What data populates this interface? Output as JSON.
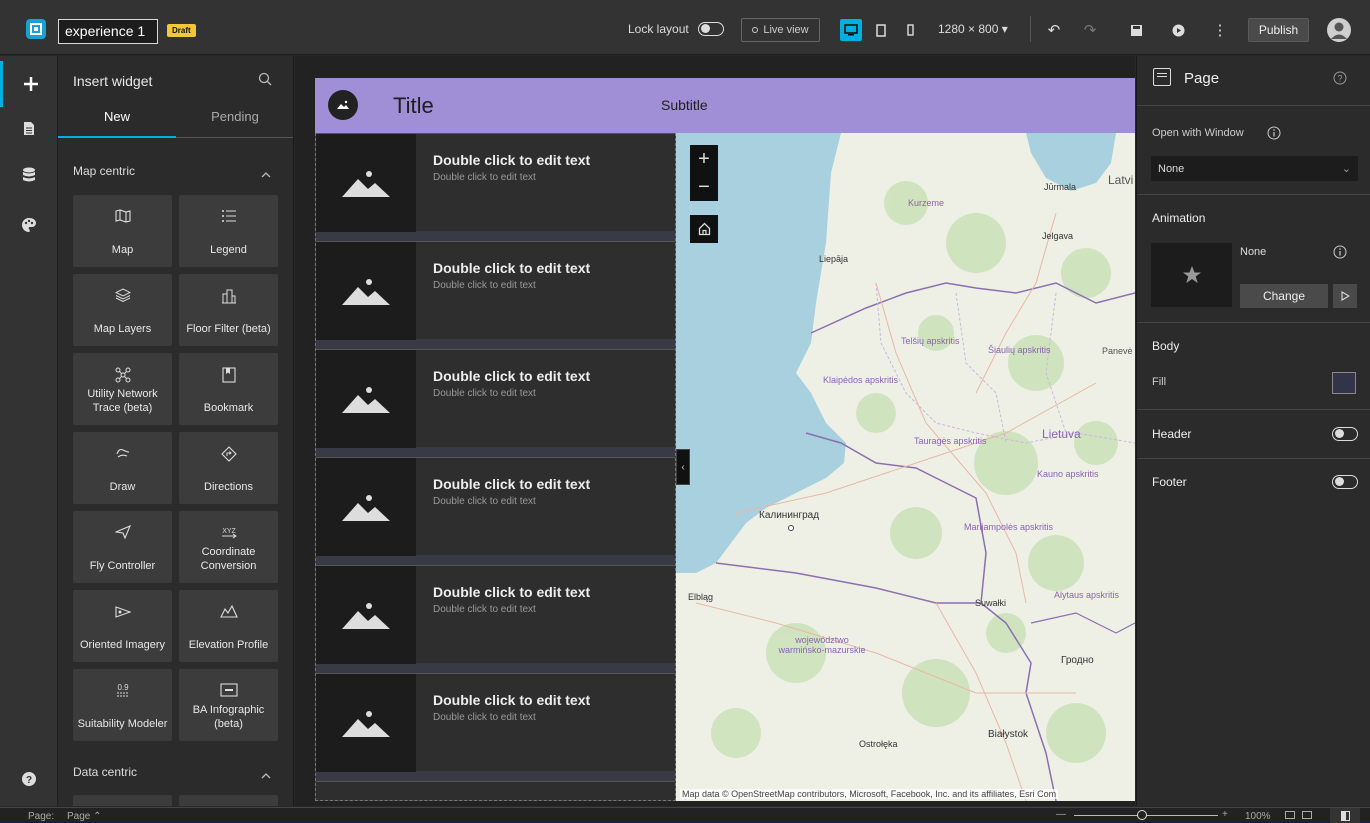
{
  "topbar": {
    "experience_title": "experience 1",
    "draft_badge": "Draft",
    "lock_layout_label": "Lock layout",
    "live_view_label": "Live view",
    "resolution": "1280 × 800",
    "publish_label": "Publish"
  },
  "insert_panel": {
    "title": "Insert widget",
    "tabs": [
      "New",
      "Pending"
    ],
    "section_map": "Map centric",
    "section_data": "Data centric",
    "widgets": [
      {
        "label": "Map",
        "icon": "map-icon"
      },
      {
        "label": "Legend",
        "icon": "legend-icon"
      },
      {
        "label": "Map Layers",
        "icon": "layers-icon"
      },
      {
        "label": "Floor Filter (beta)",
        "icon": "floor-filter-icon"
      },
      {
        "label": "Utility Network Trace (beta)",
        "icon": "utility-network-icon"
      },
      {
        "label": "Bookmark",
        "icon": "bookmark-icon"
      },
      {
        "label": "Draw",
        "icon": "draw-icon"
      },
      {
        "label": "Directions",
        "icon": "directions-icon"
      },
      {
        "label": "Fly Controller",
        "icon": "fly-controller-icon"
      },
      {
        "label": "Coordinate Conversion",
        "icon": "coordinate-icon"
      },
      {
        "label": "Oriented Imagery",
        "icon": "oriented-imagery-icon"
      },
      {
        "label": "Elevation Profile",
        "icon": "elevation-icon"
      },
      {
        "label": "Suitability Modeler",
        "icon": "suitability-icon"
      },
      {
        "label": "BA Infographic (beta)",
        "icon": "infographic-icon"
      }
    ]
  },
  "page": {
    "header_title": "Title",
    "header_subtitle": "Subtitle",
    "list_items": [
      {
        "title": "Double click to edit text",
        "subtitle": "Double click to edit text"
      },
      {
        "title": "Double click to edit text",
        "subtitle": "Double click to edit text"
      },
      {
        "title": "Double click to edit text",
        "subtitle": "Double click to edit text"
      },
      {
        "title": "Double click to edit text",
        "subtitle": "Double click to edit text"
      },
      {
        "title": "Double click to edit text",
        "subtitle": "Double click to edit text"
      },
      {
        "title": "Double click to edit text",
        "subtitle": "Double click to edit text"
      }
    ],
    "map_labels": [
      "Jūrmala",
      "Latvi",
      "Kurzeme",
      "Jelgava",
      "Liepāja",
      "Telšių apskritis",
      "Šiaulių apskritis",
      "Panevė",
      "Klaipėdos apskritis",
      "Tauragės apskritis",
      "Lietuva",
      "Kauno apskritis",
      "Калининград",
      "Marijampolės apskritis",
      "Elbląg",
      "Suwałki",
      "Alytaus apskritis",
      "województwo warmińsko-mazurskie",
      "Гродно",
      "Białystok",
      "Ostrołęka"
    ],
    "map_attribution": "Map data © OpenStreetMap contributors, Microsoft, Facebook, Inc. and its affiliates, Esri Com"
  },
  "right_panel": {
    "title": "Page",
    "open_with_window_label": "Open with Window",
    "open_with_window_value": "None",
    "animation_label": "Animation",
    "animation_value": "None",
    "change_label": "Change",
    "body_label": "Body",
    "fill_label": "Fill",
    "header_label": "Header",
    "footer_label": "Footer"
  },
  "bottombar": {
    "page_label": "Page:",
    "page_value": "Page",
    "zoom": "100%"
  },
  "colors": {
    "accent": "#00b0e0",
    "header_band": "#a08fd6",
    "draft": "#f4c63a"
  }
}
